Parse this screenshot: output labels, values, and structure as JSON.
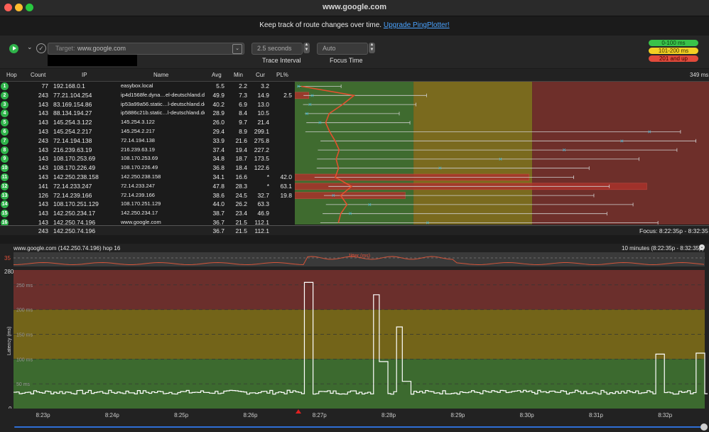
{
  "window": {
    "title": "www.google.com"
  },
  "promo": {
    "text": "Keep track of route changes over time.",
    "link": "Upgrade PingPlotter!"
  },
  "toolbar": {
    "target_label": "Target:",
    "target_value": "www.google.com",
    "interval_value": "2.5 seconds",
    "interval_label": "Trace Interval",
    "focus_value": "Auto",
    "focus_label": "Focus Time"
  },
  "legend": [
    {
      "label": "0-100 ms",
      "color": "#39c24a",
      "text_color": "#0b3d12"
    },
    {
      "label": "101-200 ms",
      "color": "#f2d024",
      "text_color": "#3d3000"
    },
    {
      "label": "201 and up",
      "color": "#e24a3b",
      "text_color": "#3d0000"
    }
  ],
  "table": {
    "headers": {
      "hop": "Hop",
      "count": "Count",
      "ip": "IP",
      "name": "Name",
      "avg": "Avg",
      "min": "Min",
      "cur": "Cur",
      "pl": "PL%"
    },
    "graph_max_label": "349 ms",
    "rows": [
      {
        "hop": "1",
        "count": "77",
        "ip": "192.168.0.1",
        "name": "easybox.local",
        "avg": "5.5",
        "min": "2.2",
        "cur": "3.2",
        "pl": "",
        "plv": 0,
        "avgv": 5.5,
        "minv": 2.2,
        "maxv": 39,
        "curv": 3.2
      },
      {
        "hop": "2",
        "count": "243",
        "ip": "77.21.104.254",
        "name": "ip4d1568fe.dyna…el-deutschland.de",
        "avg": "49.9",
        "min": "7.3",
        "cur": "14.9",
        "pl": "2.5",
        "plv": 2.5,
        "avgv": 49.9,
        "minv": 7.3,
        "maxv": 111,
        "curv": 14.9
      },
      {
        "hop": "3",
        "count": "143",
        "ip": "83.169.154.86",
        "name": "ip53a99a56.static…l-deutschland.de",
        "avg": "40.2",
        "min": "6.9",
        "cur": "13.0",
        "pl": "",
        "plv": 0,
        "avgv": 40.2,
        "minv": 6.9,
        "maxv": 102,
        "curv": 13.0
      },
      {
        "hop": "4",
        "count": "143",
        "ip": "88.134.194.27",
        "name": "ip5886c21b.static…l-deutschland.de",
        "avg": "28.9",
        "min": "8.4",
        "cur": "10.5",
        "pl": "",
        "plv": 0,
        "avgv": 28.9,
        "minv": 8.4,
        "maxv": 88,
        "curv": 10.5
      },
      {
        "hop": "5",
        "count": "143",
        "ip": "145.254.3.122",
        "name": "145.254.3.122",
        "avg": "26.0",
        "min": "9.7",
        "cur": "21.4",
        "pl": "",
        "plv": 0,
        "avgv": 26.0,
        "minv": 9.7,
        "maxv": 97,
        "curv": 21.4
      },
      {
        "hop": "6",
        "count": "143",
        "ip": "145.254.2.217",
        "name": "145.254.2.217",
        "avg": "29.4",
        "min": "8.9",
        "cur": "299.1",
        "pl": "",
        "plv": 0,
        "avgv": 29.4,
        "minv": 8.9,
        "maxv": 325,
        "curv": 299.1
      },
      {
        "hop": "7",
        "count": "243",
        "ip": "72.14.194.138",
        "name": "72.14.194.138",
        "avg": "33.9",
        "min": "21.6",
        "cur": "275.8",
        "pl": "",
        "plv": 0,
        "avgv": 33.9,
        "minv": 21.6,
        "maxv": 338,
        "curv": 275.8
      },
      {
        "hop": "8",
        "count": "143",
        "ip": "216.239.63.19",
        "name": "216.239.63.19",
        "avg": "37.4",
        "min": "19.4",
        "cur": "227.2",
        "pl": "",
        "plv": 0,
        "avgv": 37.4,
        "minv": 19.4,
        "maxv": 322,
        "curv": 227.2
      },
      {
        "hop": "9",
        "count": "143",
        "ip": "108.170.253.69",
        "name": "108.170.253.69",
        "avg": "34.8",
        "min": "18.7",
        "cur": "173.5",
        "pl": "",
        "plv": 0,
        "avgv": 34.8,
        "minv": 18.7,
        "maxv": 290,
        "curv": 173.5
      },
      {
        "hop": "10",
        "count": "143",
        "ip": "108.170.226.49",
        "name": "108.170.226.49",
        "avg": "36.8",
        "min": "18.4",
        "cur": "122.6",
        "pl": "",
        "plv": 0,
        "avgv": 36.8,
        "minv": 18.4,
        "maxv": 248,
        "curv": 122.6
      },
      {
        "hop": "11",
        "count": "143",
        "ip": "142.250.238.158",
        "name": "142.250.238.158",
        "avg": "34.1",
        "min": "16.6",
        "cur": "*",
        "pl": "42.0",
        "plv": 42.0,
        "avgv": 34.1,
        "minv": 16.6,
        "maxv": 235,
        "curv": null
      },
      {
        "hop": "12",
        "count": "141",
        "ip": "72.14.233.247",
        "name": "72.14.233.247",
        "avg": "47.8",
        "min": "28.3",
        "cur": "*",
        "pl": "63.1",
        "plv": 63.1,
        "avgv": 47.8,
        "minv": 28.3,
        "maxv": 265,
        "curv": null
      },
      {
        "hop": "13",
        "count": "126",
        "ip": "72.14.239.166",
        "name": "72.14.239.166",
        "avg": "38.6",
        "min": "24.5",
        "cur": "32.7",
        "pl": "19.8",
        "plv": 19.8,
        "avgv": 38.6,
        "minv": 24.5,
        "maxv": 252,
        "curv": 32.7
      },
      {
        "hop": "14",
        "count": "143",
        "ip": "108.170.251.129",
        "name": "108.170.251.129",
        "avg": "44.0",
        "min": "26.2",
        "cur": "63.3",
        "pl": "",
        "plv": 0,
        "avgv": 44.0,
        "minv": 26.2,
        "maxv": 285,
        "curv": 63.3
      },
      {
        "hop": "15",
        "count": "143",
        "ip": "142.250.234.17",
        "name": "142.250.234.17",
        "avg": "38.7",
        "min": "23.4",
        "cur": "46.9",
        "pl": "",
        "plv": 0,
        "avgv": 38.7,
        "minv": 23.4,
        "maxv": 263,
        "curv": 46.9
      },
      {
        "hop": "16",
        "count": "143",
        "ip": "142.250.74.196",
        "name": "www.google.com",
        "avg": "36.7",
        "min": "21.5",
        "cur": "112.1",
        "pl": "",
        "plv": 0,
        "avgv": 36.7,
        "minv": 21.5,
        "maxv": 306,
        "curv": 112.1
      }
    ],
    "summary": {
      "count": "243",
      "ip": "142.250.74.196",
      "avg": "36.7",
      "min": "21.5",
      "cur": "112.1",
      "focus": "Focus: 8:22:35p - 8:32:35"
    }
  },
  "lower": {
    "title": "www.google.com (142.250.74.196) hop 16",
    "range": "10 minutes (8:22:35p - 8:32:35p)",
    "jitter_label": "Jitter (ms)",
    "jitter_max": "35",
    "ymax_label": "280",
    "y0_label": "0",
    "ylabel": "Latency (ms)",
    "grid_labels": [
      "250 ms",
      "200 ms",
      "150 ms",
      "100 ms",
      "50 ms"
    ],
    "xticks": [
      "8:23p",
      "8:24p",
      "8:25p",
      "8:26p",
      "8:27p",
      "8:28p",
      "8:29p",
      "8:30p",
      "8:31p",
      "8:32p"
    ]
  },
  "chart_data": {
    "type": "line",
    "title": "www.google.com (142.250.74.196) hop 16",
    "ylabel": "Latency (ms)",
    "ylim": [
      0,
      280
    ],
    "xticks": [
      "8:23p",
      "8:24p",
      "8:25p",
      "8:26p",
      "8:27p",
      "8:28p",
      "8:29p",
      "8:30p",
      "8:31p",
      "8:32p"
    ],
    "spikes": [
      {
        "time": "8:26:50p",
        "value": 255
      },
      {
        "time": "8:27:50p",
        "value": 230
      },
      {
        "time": "8:27:55p",
        "value": 95
      },
      {
        "time": "8:28:10p",
        "value": 165
      },
      {
        "time": "8:28:15p",
        "value": 55
      },
      {
        "time": "8:31:55p",
        "value": 110
      },
      {
        "time": "8:32:30p",
        "value": 112
      }
    ],
    "baseline": 33
  }
}
